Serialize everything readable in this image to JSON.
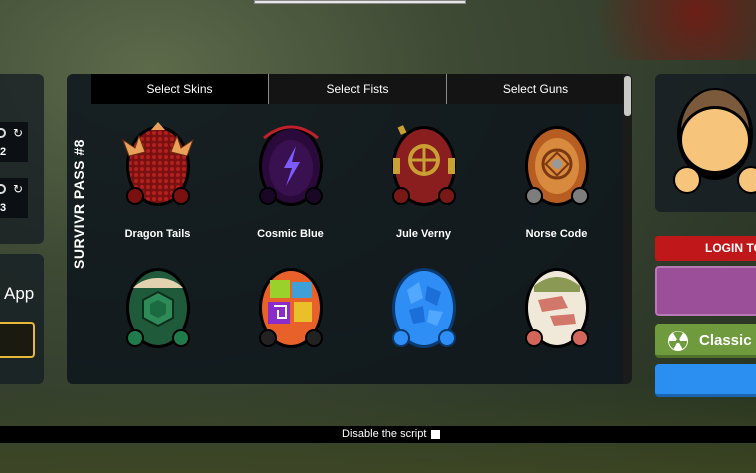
{
  "pass_title": "SURVIVR PASS #8",
  "tabs": [
    {
      "label": "Select Skins",
      "active": true
    },
    {
      "label": "Select Fists",
      "active": false
    },
    {
      "label": "Select Guns",
      "active": false
    }
  ],
  "skins": [
    {
      "name": "Dragon Tails",
      "icon": "dragon-tails-skin-icon"
    },
    {
      "name": "Cosmic Blue",
      "icon": "cosmic-blue-skin-icon"
    },
    {
      "name": "Jule Verny",
      "icon": "jule-verny-skin-icon"
    },
    {
      "name": "Norse Code",
      "icon": "norse-code-skin-icon"
    },
    {
      "name": "",
      "icon": "hex-turtle-skin-icon"
    },
    {
      "name": "",
      "icon": "maze-neon-skin-icon"
    },
    {
      "name": "",
      "icon": "blue-crystal-skin-icon"
    },
    {
      "name": "",
      "icon": "camo-tan-skin-icon"
    }
  ],
  "left_panel": {
    "row1_num": "2",
    "row2_num": "3",
    "app_label": "App"
  },
  "right_panel": {
    "login_label": "LOGIN TO",
    "classic_label": "Classic"
  },
  "footer": {
    "disable_script_label": "Disable the script"
  },
  "colors": {
    "login_red": "#c0171b",
    "purple_button": "#9b4f99",
    "classic_green": "#6f9a3d",
    "blue_button": "#2a8ff0",
    "app_border": "#e6b93a"
  }
}
